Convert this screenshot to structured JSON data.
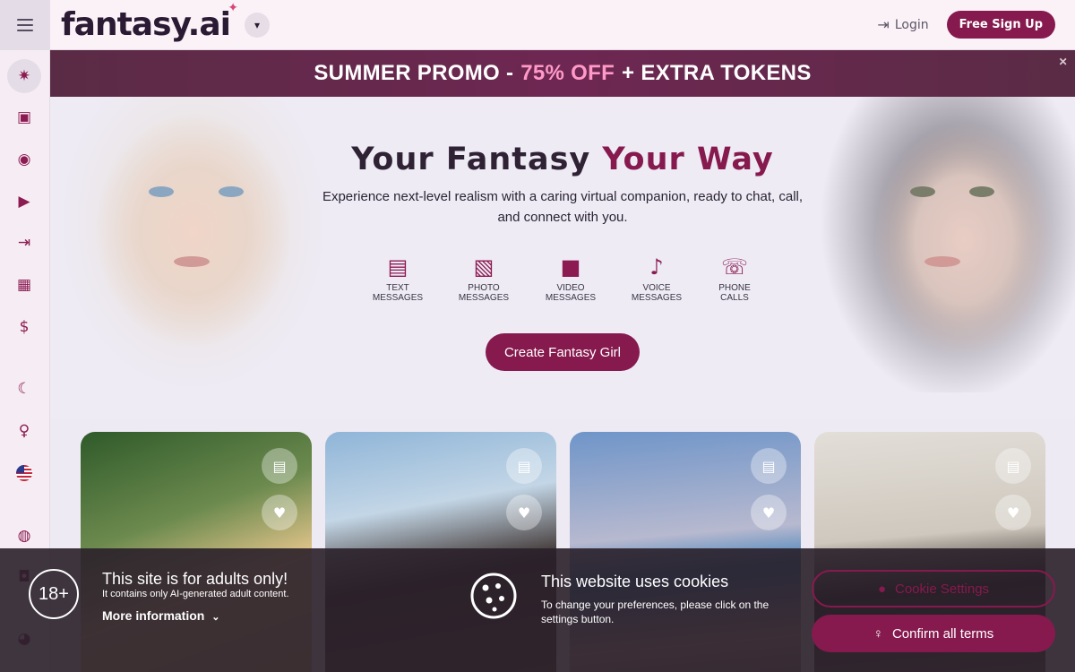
{
  "header": {
    "logo": "fantasy.ai",
    "login_label": "Login",
    "signup_label": "Free Sign Up"
  },
  "promo": {
    "part1": "SUMMER PROMO -",
    "highlight": "75% OFF",
    "part2": "+ EXTRA TOKENS"
  },
  "hero": {
    "title_part1": "Your Fantasy",
    "title_accent": "Your Way",
    "subtitle": "Experience next-level realism with a caring virtual companion, ready to chat, call, and connect with you.",
    "features": [
      {
        "line1": "TEXT",
        "line2": "MESSAGES"
      },
      {
        "line1": "PHOTO",
        "line2": "MESSAGES"
      },
      {
        "line1": "VIDEO",
        "line2": "MESSAGES"
      },
      {
        "line1": "VOICE",
        "line2": "MESSAGES"
      },
      {
        "line1": "PHONE",
        "line2": "CALLS"
      }
    ],
    "cta_label": "Create Fantasy Girl"
  },
  "consent": {
    "age_badge": "18+",
    "adult_title": "This site is for adults only!",
    "adult_desc": "It contains only AI-generated adult content.",
    "more_info": "More information",
    "cookie_title": "This website uses cookies",
    "cookie_desc": "To change your preferences, please click on the settings button.",
    "cookie_settings_label": "Cookie Settings",
    "confirm_label": "Confirm all terms"
  },
  "colors": {
    "brand": "#861a4e",
    "accent_pink": "#ff9ac8"
  }
}
